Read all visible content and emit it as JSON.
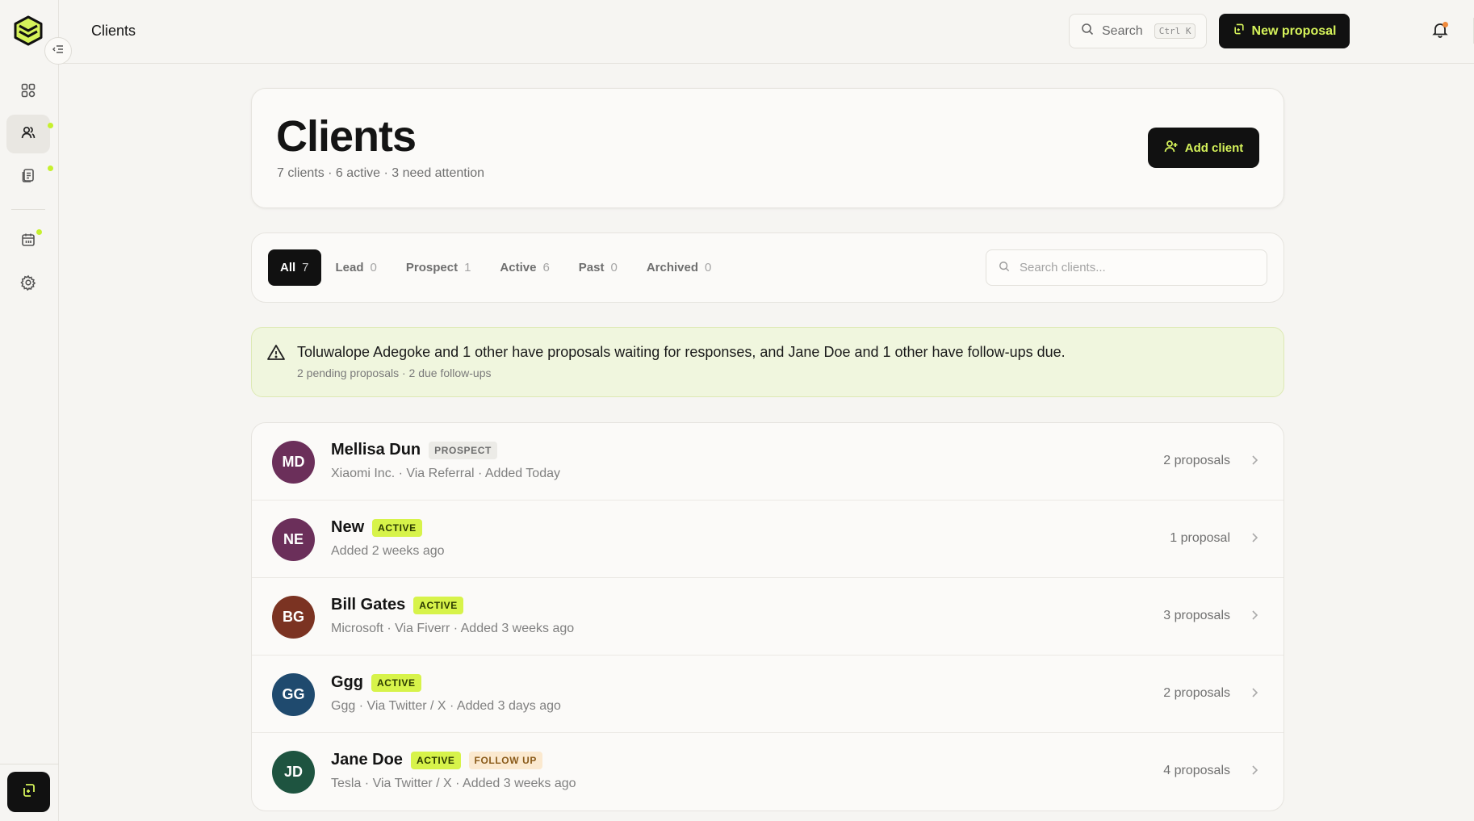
{
  "topbar": {
    "title": "Clients",
    "search_label": "Search",
    "search_shortcut": "Ctrl K",
    "new_proposal_label": "New proposal"
  },
  "header": {
    "title": "Clients",
    "subtitle": "7 clients · 6 active · 3 need attention",
    "add_client_label": "Add client"
  },
  "filters": {
    "tabs": [
      {
        "label": "All",
        "count": "7"
      },
      {
        "label": "Lead",
        "count": "0"
      },
      {
        "label": "Prospect",
        "count": "1"
      },
      {
        "label": "Active",
        "count": "6"
      },
      {
        "label": "Past",
        "count": "0"
      },
      {
        "label": "Archived",
        "count": "0"
      }
    ],
    "search_placeholder": "Search clients..."
  },
  "alert": {
    "message": "Toluwalope Adegoke and 1 other have proposals waiting for responses, and Jane Doe and 1 other have follow-ups due.",
    "detail": "2 pending proposals · 2 due follow-ups"
  },
  "clients": [
    {
      "initials": "MD",
      "name": "Mellisa Dun",
      "status": "PROSPECT",
      "meta": "Xiaomi Inc. · Via Referral · Added Today",
      "proposals": "2 proposals",
      "color": "#6b2f5a"
    },
    {
      "initials": "NE",
      "name": "New",
      "status": "ACTIVE",
      "meta": "Added 2 weeks ago",
      "proposals": "1 proposal",
      "color": "#6b2f5a"
    },
    {
      "initials": "BG",
      "name": "Bill Gates",
      "status": "ACTIVE",
      "meta": "Microsoft · Via Fiverr · Added 3 weeks ago",
      "proposals": "3 proposals",
      "color": "#7b3322"
    },
    {
      "initials": "GG",
      "name": "Ggg",
      "status": "ACTIVE",
      "meta": "Ggg · Via Twitter / X · Added 3 days ago",
      "proposals": "2 proposals",
      "color": "#1f4a6e"
    },
    {
      "initials": "JD",
      "name": "Jane Doe",
      "status": "ACTIVE",
      "extra_badge": "FOLLOW UP",
      "meta": "Tesla · Via Twitter / X · Added 3 weeks ago",
      "proposals": "4 proposals",
      "color": "#1e5440"
    }
  ],
  "colors": {
    "accent": "#d7f34a",
    "dark": "#111111",
    "background": "#f6f5f2"
  }
}
